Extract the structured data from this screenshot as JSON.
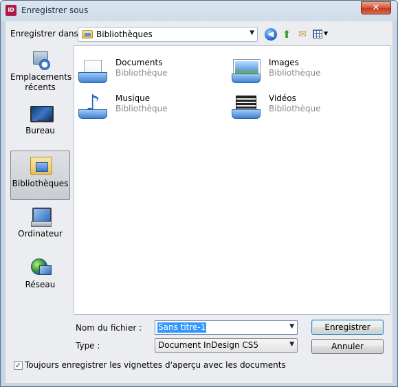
{
  "window": {
    "title": "Enregistrer sous",
    "app_icon_text": "ID",
    "close_glyph": "✕"
  },
  "toolbar": {
    "save_in_label": "Enregistrer dans :",
    "save_in_value": "Bibliothèques",
    "dropdown_glyph": "▼",
    "back_glyph": "◀",
    "up_glyph": "⬆",
    "new_folder_glyph": "✉",
    "views_arrow_glyph": "▼"
  },
  "places": [
    {
      "label_line1": "Emplacements",
      "label_line2": "récents",
      "icon": "recent-places-icon"
    },
    {
      "label_line1": "Bureau",
      "label_line2": "",
      "icon": "desktop-icon"
    },
    {
      "label_line1": "Bibliothèques",
      "label_line2": "",
      "icon": "libraries-icon",
      "selected": true
    },
    {
      "label_line1": "Ordinateur",
      "label_line2": "",
      "icon": "computer-icon"
    },
    {
      "label_line1": "Réseau",
      "label_line2": "",
      "icon": "network-icon"
    }
  ],
  "libraries": [
    {
      "name": "Documents",
      "type": "Bibliothèque",
      "icon": "documents-library-icon"
    },
    {
      "name": "Images",
      "type": "Bibliothèque",
      "icon": "images-library-icon"
    },
    {
      "name": "Musique",
      "type": "Bibliothèque",
      "icon": "music-library-icon"
    },
    {
      "name": "Vidéos",
      "type": "Bibliothèque",
      "icon": "videos-library-icon"
    }
  ],
  "form": {
    "filename_label": "Nom du fichier :",
    "filename_value": "Sans titre-1",
    "type_label": "Type :",
    "type_value": "Document InDesign CS5",
    "dropdown_glyph": "▼"
  },
  "buttons": {
    "save": "Enregistrer",
    "cancel": "Annuler"
  },
  "options": {
    "thumbnails_label": "Toujours enregistrer les vignettes d'aperçu avec les documents",
    "thumbnails_checked": true,
    "check_glyph": "✓"
  },
  "colors": {
    "selection": "#3399ff",
    "close_button": "#c2371b"
  }
}
